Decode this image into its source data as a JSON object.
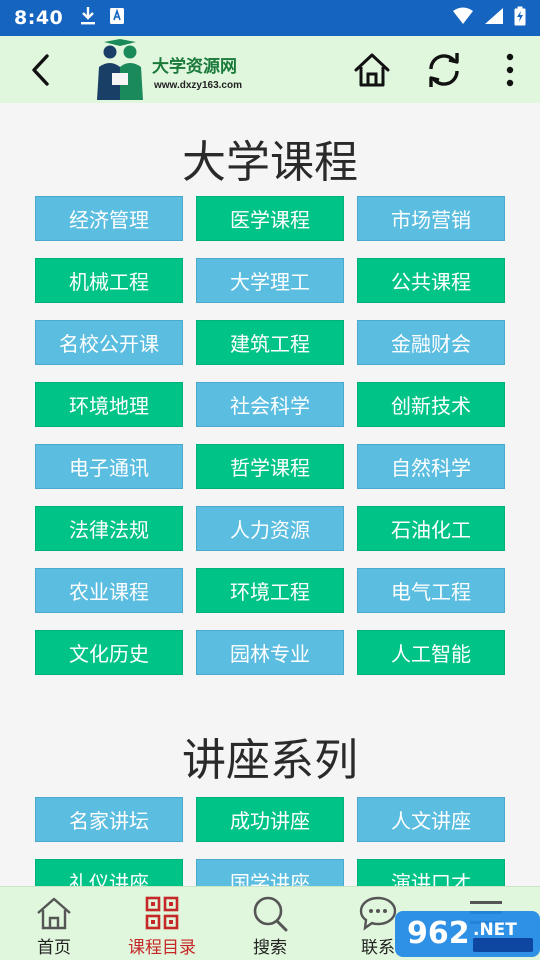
{
  "status_bar": {
    "time": "8:40"
  },
  "header": {
    "logo_title": "大学资源网",
    "logo_url": "www.dxzy163.com"
  },
  "courses": {
    "title": "大学课程",
    "items": [
      {
        "label": "经济管理",
        "color": "blue"
      },
      {
        "label": "医学课程",
        "color": "green"
      },
      {
        "label": "市场营销",
        "color": "blue"
      },
      {
        "label": "机械工程",
        "color": "green"
      },
      {
        "label": "大学理工",
        "color": "blue"
      },
      {
        "label": "公共课程",
        "color": "green"
      },
      {
        "label": "名校公开课",
        "color": "blue"
      },
      {
        "label": "建筑工程",
        "color": "green"
      },
      {
        "label": "金融财会",
        "color": "blue"
      },
      {
        "label": "环境地理",
        "color": "green"
      },
      {
        "label": "社会科学",
        "color": "blue"
      },
      {
        "label": "创新技术",
        "color": "green"
      },
      {
        "label": "电子通讯",
        "color": "blue"
      },
      {
        "label": "哲学课程",
        "color": "green"
      },
      {
        "label": "自然科学",
        "color": "blue"
      },
      {
        "label": "法律法规",
        "color": "green"
      },
      {
        "label": "人力资源",
        "color": "blue"
      },
      {
        "label": "石油化工",
        "color": "green"
      },
      {
        "label": "农业课程",
        "color": "blue"
      },
      {
        "label": "环境工程",
        "color": "green"
      },
      {
        "label": "电气工程",
        "color": "blue"
      },
      {
        "label": "文化历史",
        "color": "green"
      },
      {
        "label": "园林专业",
        "color": "blue"
      },
      {
        "label": "人工智能",
        "color": "green"
      }
    ]
  },
  "lectures": {
    "title": "讲座系列",
    "items": [
      {
        "label": "名家讲坛",
        "color": "blue"
      },
      {
        "label": "成功讲座",
        "color": "green"
      },
      {
        "label": "人文讲座",
        "color": "blue"
      },
      {
        "label": "礼仪讲座",
        "color": "green"
      },
      {
        "label": "国学讲座",
        "color": "blue"
      },
      {
        "label": "演讲口才",
        "color": "green"
      }
    ]
  },
  "bottom_nav": [
    {
      "label": "首页",
      "icon": "home-outline-icon",
      "active": false
    },
    {
      "label": "课程目录",
      "icon": "grid-icon",
      "active": true
    },
    {
      "label": "搜索",
      "icon": "search-icon",
      "active": false
    },
    {
      "label": "联系",
      "icon": "chat-icon",
      "active": false
    }
  ],
  "colors": {
    "status_bar": "#1565c0",
    "header_bg": "#e0f7dd",
    "tile_blue": "#5bbde0",
    "tile_green": "#00c487",
    "nav_active": "#c62828"
  }
}
